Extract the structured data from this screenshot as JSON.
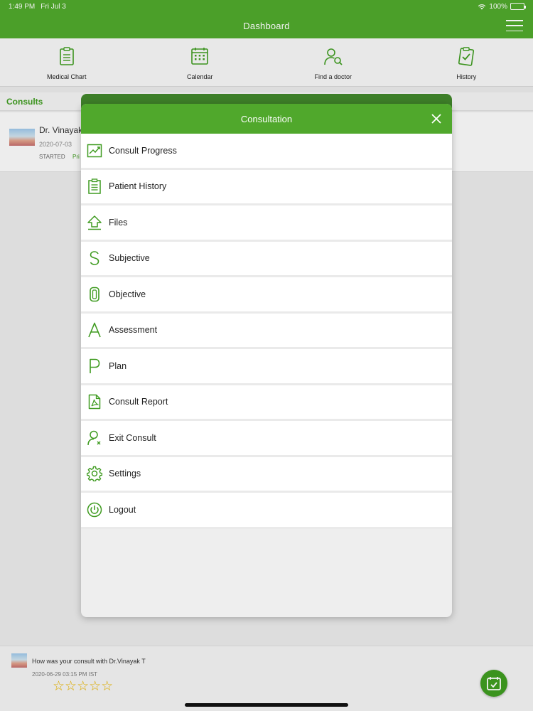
{
  "status_bar": {
    "time": "1:49 PM",
    "date": "Fri Jul 3",
    "battery": "100%"
  },
  "header": {
    "title": "Dashboard"
  },
  "toolbar": {
    "items": [
      {
        "label": "Medical Chart",
        "icon": "clipboard-icon"
      },
      {
        "label": "Calendar",
        "icon": "calendar-icon"
      },
      {
        "label": "Find a doctor",
        "icon": "doctor-search-icon"
      },
      {
        "label": "History",
        "icon": "clipboard-check-icon"
      }
    ]
  },
  "consults": {
    "heading": "Consults",
    "card": {
      "doctor": "Dr. Vinayak",
      "date": "2020-07-03",
      "status": "STARTED",
      "tag": "Pri"
    }
  },
  "modal": {
    "title": "Consultation",
    "items": [
      {
        "label": "Consult Progress",
        "icon": "chart-progress-icon"
      },
      {
        "label": "Patient History",
        "icon": "clipboard-list-icon"
      },
      {
        "label": "Files",
        "icon": "upload-arrow-icon"
      },
      {
        "label": "Subjective",
        "icon": "letter-s-icon"
      },
      {
        "label": "Objective",
        "icon": "letter-o-icon"
      },
      {
        "label": "Assessment",
        "icon": "letter-a-icon"
      },
      {
        "label": "Plan",
        "icon": "letter-p-icon"
      },
      {
        "label": "Consult Report",
        "icon": "pdf-document-icon"
      },
      {
        "label": "Exit Consult",
        "icon": "user-exit-icon"
      },
      {
        "label": "Settings",
        "icon": "gear-icon"
      },
      {
        "label": "Logout",
        "icon": "power-icon"
      }
    ]
  },
  "feedback": {
    "question": "How was your consult with Dr.Vinayak T",
    "timestamp": "2020-06-29 03:15 PM IST",
    "stars": "☆☆☆☆☆",
    "rating": 0,
    "max_rating": 5
  },
  "colors": {
    "primary": "#50a82c",
    "primary_dark": "#3d7e28",
    "text": "#222222",
    "background": "#eeeeee"
  }
}
